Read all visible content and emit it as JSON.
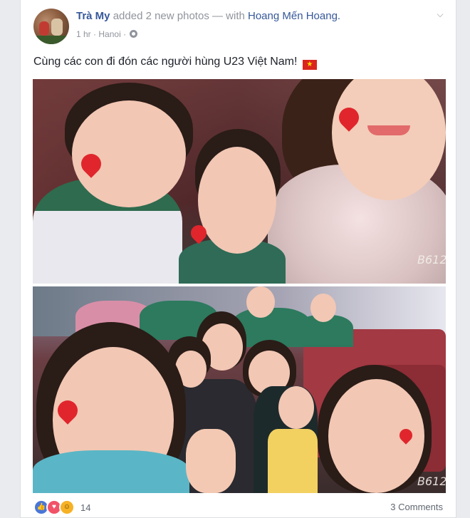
{
  "post": {
    "author": "Trà My",
    "action_text": "added 2 new photos — with",
    "tagged": "Hoang Mến Hoang.",
    "time": "1 hr",
    "separator": "·",
    "location": "Hanoi",
    "privacy_icon": "globe-icon",
    "caption": "Cùng các con đi đón các người hùng U23 Việt Nam!",
    "caption_emoji": "vietnam-flag-icon"
  },
  "photos": [
    {
      "watermark": "B612"
    },
    {
      "watermark": "B612"
    }
  ],
  "footer": {
    "reactions": [
      "like-icon",
      "love-icon",
      "haha-icon"
    ],
    "reaction_count": "14",
    "comments": "3 Comments"
  },
  "colors": {
    "link": "#365899",
    "muted": "#90949c",
    "background": "#e9ebee",
    "flag_red": "#da251d",
    "flag_star": "#ffde00"
  }
}
